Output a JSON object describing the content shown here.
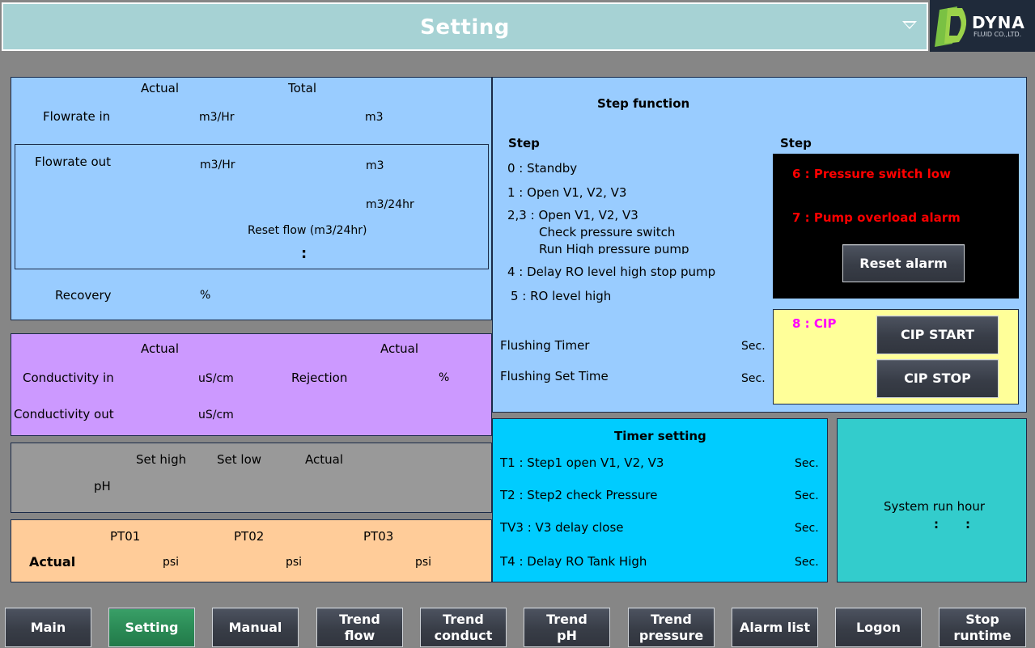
{
  "header": {
    "title": "Setting"
  },
  "logo": {
    "brand": "DYNA",
    "sub": "FLUID CO.,LTD."
  },
  "flow": {
    "actual": "Actual",
    "total": "Total",
    "in_label": "Flowrate in",
    "in_unit_actual": "m3/Hr",
    "in_unit_total": "m3",
    "out_label": "Flowrate out",
    "out_unit_actual": "m3/Hr",
    "out_unit_total": "m3",
    "daily_unit": "m3/24hr",
    "reset_label": "Reset flow (m3/24hr)",
    "reset_colon": ":",
    "recovery_label": "Recovery",
    "recovery_unit": "%"
  },
  "conductivity": {
    "actual1": "Actual",
    "actual2": "Actual",
    "in_label": "Conductivity in",
    "in_unit": "uS/cm",
    "rejection_label": "Rejection",
    "rejection_unit": "%",
    "out_label": "Conductivity out",
    "out_unit": "uS/cm"
  },
  "ph": {
    "set_high": "Set high",
    "set_low": "Set low",
    "actual": "Actual",
    "label": "pH"
  },
  "pressure": {
    "pt01": "PT01",
    "pt02": "PT02",
    "pt03": "PT03",
    "actual": "Actual",
    "unit1": "psi",
    "unit2": "psi",
    "unit3": "psi"
  },
  "step": {
    "title": "Step function",
    "left_header": "Step",
    "right_header": "Step",
    "s0": "0 : Standby",
    "s1": "1 : Open V1, V2, V3",
    "s23": "2,3 : Open V1, V2, V3",
    "s23b": "Check pressure switch",
    "s23c": "Run High pressure pump",
    "s4": "4 : Delay RO level high stop pump",
    "s5": "5 : RO level high",
    "flushing_timer": "Flushing Timer",
    "flushing_timer_unit": "Sec.",
    "flushing_set": "Flushing Set Time",
    "flushing_set_unit": "Sec."
  },
  "alarm": {
    "a6": "6 : Pressure switch low",
    "a7": "7 : Pump overload alarm",
    "reset": "Reset alarm"
  },
  "cip": {
    "label": "8 : CIP",
    "start": "CIP START",
    "stop": "CIP STOP"
  },
  "timer": {
    "title": "Timer setting",
    "t1": "T1 : Step1 open V1, V2, V3",
    "t1_unit": "Sec.",
    "t2": "T2 : Step2 check Pressure",
    "t2_unit": "Sec.",
    "t3": "TV3 : V3 delay close",
    "t3_unit": "Sec.",
    "t4": "T4 : Delay RO Tank High",
    "t4_unit": "Sec."
  },
  "runhour": {
    "label": "System run hour",
    "sep1": ":",
    "sep2": ":"
  },
  "nav": {
    "main": "Main",
    "setting": "Setting",
    "manual": "Manual",
    "trend_flow_1": "Trend",
    "trend_flow_2": "flow",
    "trend_conduct_1": "Trend",
    "trend_conduct_2": "conduct",
    "trend_ph_1": "Trend",
    "trend_ph_2": "pH",
    "trend_pressure_1": "Trend",
    "trend_pressure_2": "pressure",
    "alarm_list": "Alarm list",
    "logon": "Logon",
    "stop_runtime_1": "Stop",
    "stop_runtime_2": "runtime"
  },
  "colors": {
    "header": "#a6d2d4",
    "flow_panel": "#99ccff",
    "cond_panel": "#cc99ff",
    "ph_panel": "#999999",
    "pressure_panel": "#ffcc99",
    "timer_panel": "#00ccff",
    "runhour_panel": "#33cccc",
    "alarm_text": "#ff0000",
    "cip_text": "#ff00ff",
    "cip_panel": "#ffff99",
    "active_nav": "#2a8a55"
  }
}
